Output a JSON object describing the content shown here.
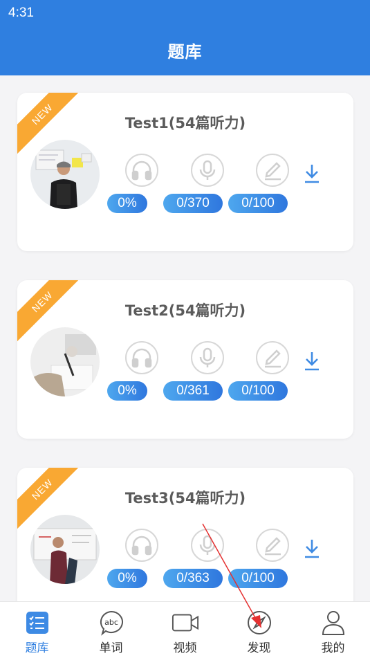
{
  "status_bar": {
    "time": "4:31"
  },
  "header": {
    "title": "题库"
  },
  "cards": [
    {
      "title": "Test1(54篇听力)",
      "badge": "NEW",
      "listening": "0%",
      "speaking": "0/370",
      "writing": "0/100"
    },
    {
      "title": "Test2(54篇听力)",
      "badge": "NEW",
      "listening": "0%",
      "speaking": "0/361",
      "writing": "0/100"
    },
    {
      "title": "Test3(54篇听力)",
      "badge": "NEW",
      "listening": "0%",
      "speaking": "0/363",
      "writing": "0/100"
    }
  ],
  "tabs": [
    {
      "label": "题库",
      "icon": "checklist-icon",
      "active": true
    },
    {
      "label": "单词",
      "icon": "abc-bubble-icon",
      "active": false
    },
    {
      "label": "视频",
      "icon": "video-camera-icon",
      "active": false
    },
    {
      "label": "发现",
      "icon": "compass-icon",
      "active": false
    },
    {
      "label": "我的",
      "icon": "user-icon",
      "active": false
    }
  ],
  "colors": {
    "primary": "#2f7fe0",
    "ribbon": "#f9a833",
    "pill_start": "#4ea7ee",
    "pill_end": "#2f77de",
    "annotation_arrow": "#e53030"
  }
}
